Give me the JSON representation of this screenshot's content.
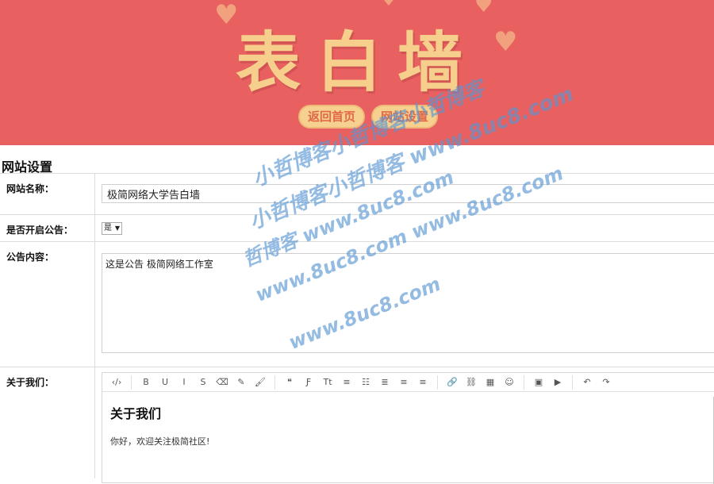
{
  "banner": {
    "title": "表白墙",
    "nav": [
      "返回首页",
      "网站设置"
    ]
  },
  "section_title": "网站设置",
  "form": {
    "site_name": {
      "label": "网站名称：",
      "value": "极简网络大学告白墙"
    },
    "notice_enabled": {
      "label": "是否开启公告：",
      "selected": "是"
    },
    "notice_content": {
      "label": "公告内容：",
      "value": "这是公告 极简网络工作室"
    },
    "about": {
      "label": "关于我们：",
      "heading": "关于我们",
      "text": "你好，欢迎关注极简社区!"
    }
  },
  "toolbar_icons": [
    "code",
    "bold",
    "underline",
    "italic",
    "strikethrough",
    "eraser",
    "pencil",
    "brush",
    "quote",
    "font",
    "text-size",
    "list-ul",
    "list-ol",
    "align-left",
    "align-center",
    "align-right",
    "link",
    "unlink",
    "table",
    "emoji",
    "image",
    "video",
    "undo",
    "redo"
  ],
  "toolbar_glyphs": [
    "‹/›",
    "B",
    "U",
    "I",
    "S",
    "⌫",
    "✎",
    "🖌",
    "❝",
    "Ƒ",
    "Tt",
    "≡",
    "☷",
    "≣",
    "≡",
    "≡",
    "🔗",
    "⛓",
    "▦",
    "☺",
    "▣",
    "▶",
    "↶",
    "↷"
  ],
  "watermark": [
    "小哲博客小哲博客小哲博客",
    "小哲博客小哲博客 www.8uc8.com",
    "哲博客 www.8uc8.com",
    "www.8uc8.com www.8uc8.com",
    "www.8uc8.com"
  ],
  "colors": {
    "banner": "#e86060",
    "title": "#f6cf8c",
    "button": "#f6d08e"
  }
}
